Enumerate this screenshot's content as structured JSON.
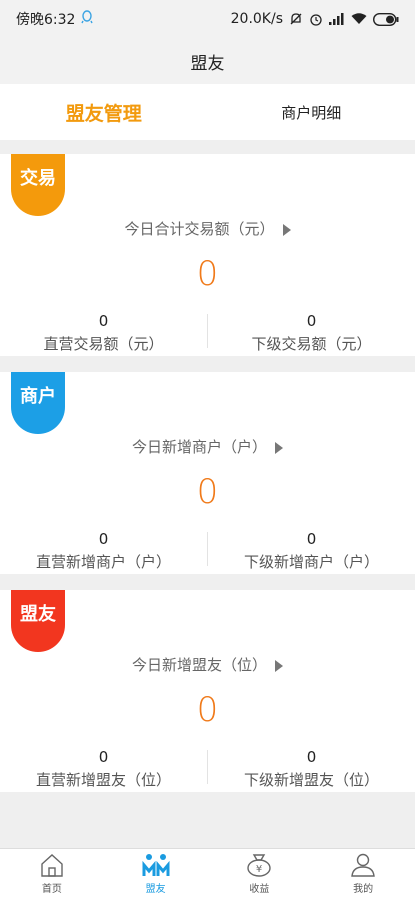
{
  "status_bar": {
    "time": "傍晚6:32",
    "speed": "20.0K/s"
  },
  "header": {
    "title": "盟友"
  },
  "tabs": [
    {
      "label": "盟友管理",
      "active": true
    },
    {
      "label": "商户明细",
      "active": false
    }
  ],
  "cards": [
    {
      "badge": "交易",
      "badge_color": "#f49a0c",
      "title": "今日合计交易额（元）",
      "total": "0",
      "left_value": "0",
      "left_label": "直营交易额（元）",
      "right_value": "0",
      "right_label": "下级交易额（元）"
    },
    {
      "badge": "商户",
      "badge_color": "#1c9fe6",
      "title": "今日新增商户（户）",
      "total": "0",
      "left_value": "0",
      "left_label": "直营新增商户（户）",
      "right_value": "0",
      "right_label": "下级新增商户（户）"
    },
    {
      "badge": "盟友",
      "badge_color": "#f2361f",
      "title": "今日新增盟友（位）",
      "total": "0",
      "left_value": "0",
      "left_label": "直营新增盟友（位）",
      "right_value": "0",
      "right_label": "下级新增盟友（位）"
    }
  ],
  "bottom_nav": [
    {
      "label": "首页",
      "icon": "home-icon"
    },
    {
      "label": "盟友",
      "icon": "allies-icon",
      "active": true
    },
    {
      "label": "收益",
      "icon": "money-bag-icon"
    },
    {
      "label": "我的",
      "icon": "user-icon"
    }
  ]
}
